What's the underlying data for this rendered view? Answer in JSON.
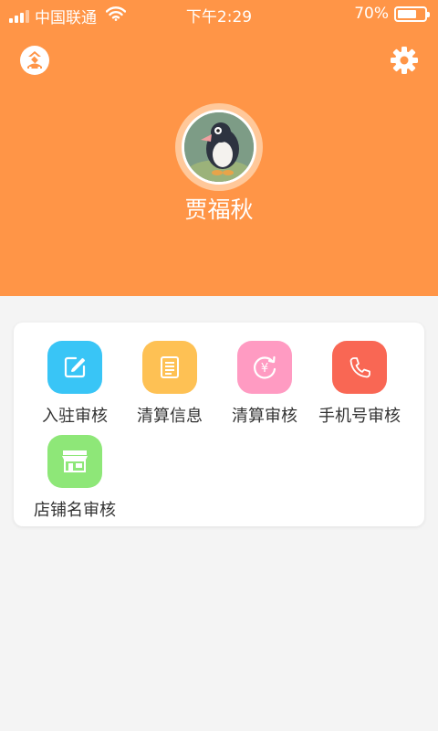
{
  "status_bar": {
    "carrier": "中国联通",
    "time": "下午2:29",
    "battery": "70%",
    "battery_level": 0.7
  },
  "profile": {
    "user_name": "贾福秋"
  },
  "menu": [
    {
      "label": "入驻审核",
      "icon": "edit-icon",
      "color": "#39c5f6"
    },
    {
      "label": "清算信息",
      "icon": "document-icon",
      "color": "#fec154"
    },
    {
      "label": "清算审核",
      "icon": "refresh-yen-icon",
      "color": "#ff9bc2"
    },
    {
      "label": "手机号审核",
      "icon": "phone-icon",
      "color": "#f96754"
    },
    {
      "label": "店铺名审核",
      "icon": "storefront-icon",
      "color": "#8ee778"
    }
  ],
  "colors": {
    "header": "#ff9547",
    "background": "#f4f4f4"
  }
}
